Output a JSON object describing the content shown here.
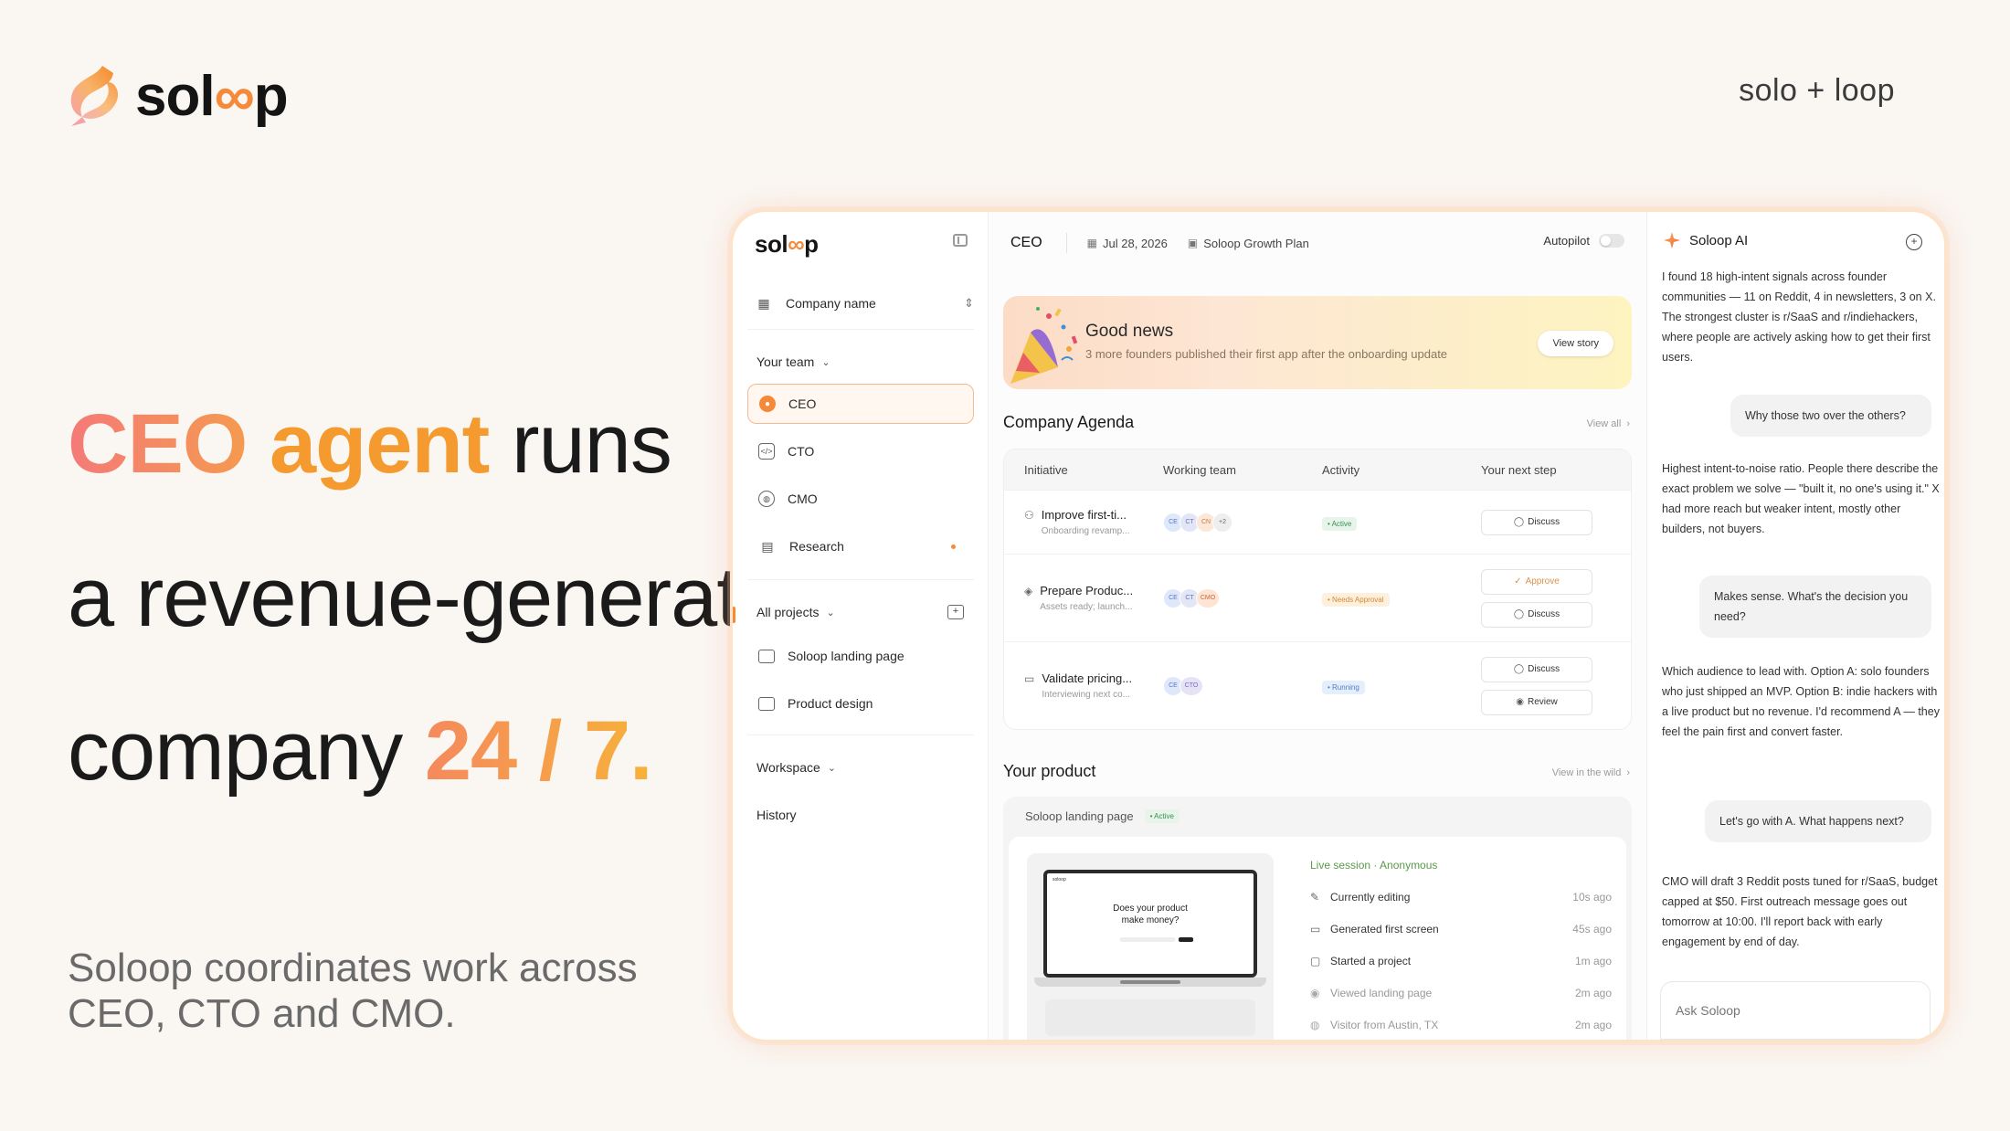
{
  "brand": {
    "name_prefix": "sol",
    "name_loop": "∞",
    "name_suffix": "p",
    "tagline": "solo + loop"
  },
  "hero": {
    "line1_a": "CEO",
    "line1_b": "agent",
    "line1_c": "runs",
    "line2": "a revenue-generate",
    "line3_a": "company",
    "line3_b": "24 / 7.",
    "subtitle": "Soloop coordinates work across CEO, CTO and CMO."
  },
  "colors": {
    "accent": "#f58a3a",
    "active_green": "#3c8e54",
    "approval_orange": "#d48836",
    "running_blue": "#4c7ecb"
  },
  "sidebar": {
    "logo_prefix": "sol",
    "logo_loop": "∞",
    "logo_suffix": "p",
    "company": "Company name",
    "team_label": "Your team",
    "team": [
      {
        "label": "CEO",
        "icon": "user-circle-icon"
      },
      {
        "label": "CTO",
        "icon": "code-icon"
      },
      {
        "label": "CMO",
        "icon": "globe-icon"
      },
      {
        "label": "Research",
        "icon": "book-icon"
      }
    ],
    "projects_label": "All projects",
    "projects": [
      {
        "label": "Soloop landing page"
      },
      {
        "label": "Product design"
      }
    ],
    "workspace_label": "Workspace",
    "history_label": "History"
  },
  "topbar": {
    "title": "CEO",
    "date": "Jul 28, 2026",
    "plan": "Soloop Growth Plan",
    "autopilot": "Autopilot"
  },
  "banner": {
    "title": "Good news",
    "subtitle": "3 more founders published their first app after the onboarding update",
    "button": "View story"
  },
  "agenda": {
    "title": "Company Agenda",
    "view_all": "View all",
    "headers": [
      "Initiative",
      "Working team",
      "Activity",
      "Your next step"
    ],
    "rows": [
      {
        "title": "Improve first-ti...",
        "sub": "Onboarding revamp...",
        "team": [
          "CE",
          "CT",
          "CN",
          "+2"
        ],
        "status": "• Active",
        "steps": [
          "Discuss"
        ]
      },
      {
        "title": "Prepare Produc...",
        "sub": "Assets ready; launch...",
        "team": [
          "CE",
          "CT",
          "CMO"
        ],
        "status": "• Needs Approval",
        "steps": [
          "Approve",
          "Discuss"
        ]
      },
      {
        "title": "Validate pricing...",
        "sub": "Interviewing next co...",
        "team": [
          "CE",
          "CTO"
        ],
        "status": "• Running",
        "steps": [
          "Discuss",
          "Review"
        ]
      }
    ]
  },
  "product": {
    "title": "Your product",
    "view_link": "View in the wild",
    "project_name": "Soloop landing page",
    "status": "• Active",
    "preview_logo": "soloop",
    "preview_title_1": "Does your product",
    "preview_title_2": "make money?",
    "live_title": "Live session · Anonymous",
    "events": [
      {
        "label": "Currently editing",
        "time": "10s ago"
      },
      {
        "label": "Generated first screen",
        "time": "45s ago"
      },
      {
        "label": "Started a project",
        "time": "1m ago"
      },
      {
        "label": "Viewed landing page",
        "time": "2m ago"
      },
      {
        "label": "Visitor from Austin, TX",
        "time": "2m ago"
      }
    ]
  },
  "ai": {
    "title": "Soloop AI",
    "messages": [
      "I found 18 high-intent signals across founder communities — 11 on Reddit, 4 in newsletters, 3 on X. The strongest cluster is r/SaaS and r/indiehackers, where people are actively asking how to get their first users.",
      "Why those two over the others?",
      "Highest intent-to-noise ratio. People there describe the exact problem we solve — \"built it, no one's using it.\" X had more reach but weaker intent, mostly other builders, not buyers.",
      "Makes sense. What's the decision you need?",
      "Which audience to lead with. Option A: solo founders who just shipped an MVP. Option B: indie hackers with a live product but no revenue. I'd recommend A — they feel the pain first and convert faster.",
      "Let's go with A. What happens next?",
      "CMO will draft 3 Reddit posts tuned for r/SaaS, budget capped at $50. First outreach message goes out tomorrow at 10:00. I'll report back with early engagement by end of day."
    ],
    "input_placeholder": "Ask Soloop"
  }
}
